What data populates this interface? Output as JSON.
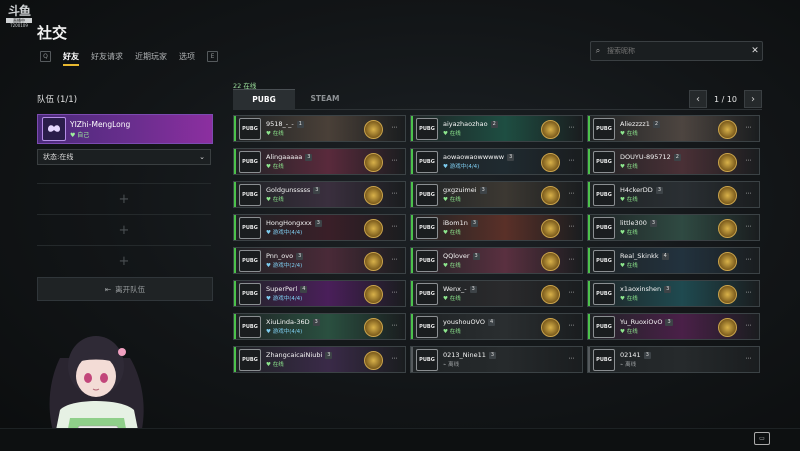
{
  "logo": {
    "mark": "斗鱼",
    "sub": "直播中",
    "id": "7200109"
  },
  "page_title": "社交",
  "nav": {
    "key_left": "Q",
    "key_right": "E",
    "tabs": [
      "好友",
      "好友请求",
      "近期玩家",
      "选项"
    ],
    "active": "好友"
  },
  "search": {
    "placeholder": "搜索昵称",
    "value": ""
  },
  "team": {
    "label": "队伍 (1/1)",
    "member": {
      "name": "YIZhi-MengLong",
      "status": "自己"
    },
    "status_select": "状态:在线",
    "leave_label": "离开队伍"
  },
  "friends": {
    "online_count": "22 在线",
    "tabs": [
      "PUBG",
      "STEAM"
    ],
    "active_tab": "PUBG",
    "page": "1 / 10",
    "cards": [
      {
        "name": "9518_-_-",
        "level": "1",
        "status": "在线",
        "kind": "on",
        "bg": "#4a4038"
      },
      {
        "name": "aiyazhaozhao",
        "level": "2",
        "status": "在线",
        "kind": "on",
        "bg": "#1e4e42"
      },
      {
        "name": "Aliezzzz1",
        "level": "2",
        "status": "在线",
        "kind": "on",
        "bg": "#4d4540"
      },
      {
        "name": "Alingaaaaa",
        "level": "3",
        "status": "在线",
        "kind": "on",
        "bg": "#5a2a3c"
      },
      {
        "name": "aowaowaowwwww",
        "level": "3",
        "status": "游戏中(4/4)",
        "kind": "game",
        "bg": "#1f2a30"
      },
      {
        "name": "DOUYU-895712",
        "level": "2",
        "status": "在线",
        "kind": "on",
        "bg": "#4a3036"
      },
      {
        "name": "Goldgunsssss",
        "level": "3",
        "status": "在线",
        "kind": "on",
        "bg": "#3a2f3e"
      },
      {
        "name": "gxgzuimei",
        "level": "3",
        "status": "在线",
        "kind": "on",
        "bg": "#3c3832"
      },
      {
        "name": "H4ckerDD",
        "level": "3",
        "status": "在线",
        "kind": "on",
        "bg": "#2a2f33"
      },
      {
        "name": "HongHongxxx",
        "level": "3",
        "status": "游戏中(4/4)",
        "kind": "game",
        "bg": "#3a1f28"
      },
      {
        "name": "iBom1n",
        "level": "3",
        "status": "在线",
        "kind": "on",
        "bg": "#5a3028"
      },
      {
        "name": "little300",
        "level": "3",
        "status": "在线",
        "kind": "on",
        "bg": "#2f4a42"
      },
      {
        "name": "Pnn_ovo",
        "level": "3",
        "status": "游戏中(2/4)",
        "kind": "game",
        "bg": "#4a2a38"
      },
      {
        "name": "QQlover",
        "level": "3",
        "status": "在线",
        "kind": "on",
        "bg": "#5a3040"
      },
      {
        "name": "Real_Skinkk",
        "level": "4",
        "status": "在线",
        "kind": "on",
        "bg": "#22323e"
      },
      {
        "name": "SuperPerl",
        "level": "4",
        "status": "游戏中(4/4)",
        "kind": "game",
        "bg": "#4a1f5a"
      },
      {
        "name": "Wenx_-",
        "level": "3",
        "status": "在线",
        "kind": "on",
        "bg": "#2a2a2c"
      },
      {
        "name": "x1aoxinshen",
        "level": "3",
        "status": "在线",
        "kind": "on",
        "bg": "#1f4a50"
      },
      {
        "name": "XiuLinda-36D",
        "level": "3",
        "status": "游戏中(4/4)",
        "kind": "game",
        "bg": "#2a5040"
      },
      {
        "name": "youshouOVO",
        "level": "4",
        "status": "在线",
        "kind": "on",
        "bg": "#2a2e30"
      },
      {
        "name": "Yu_RuoxiOvO",
        "level": "3",
        "status": "在线",
        "kind": "on",
        "bg": "#4a2048"
      },
      {
        "name": "ZhangcaicaiNiubi",
        "level": "3",
        "status": "在线",
        "kind": "on",
        "bg": "#3a2a48"
      },
      {
        "name": "0213_Nine11",
        "level": "3",
        "status": "离线",
        "kind": "off",
        "bg": "#262a2c"
      },
      {
        "name": "02141",
        "level": "3",
        "status": "离线",
        "kind": "off",
        "bg": "#262a2c"
      }
    ]
  }
}
